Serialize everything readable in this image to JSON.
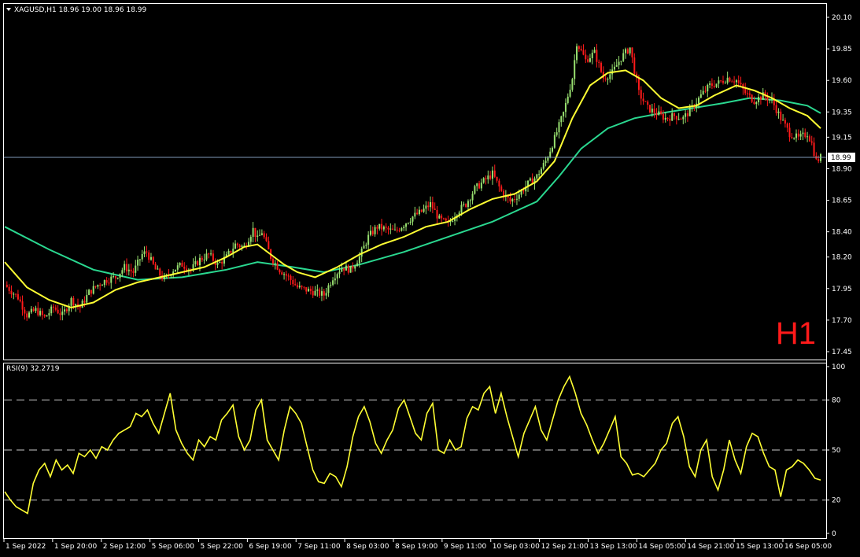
{
  "window": {
    "symbol_header": "XAGUSD,H1  18.96 19.00 18.96 18.99",
    "timeframe_watermark": "H1",
    "current_price_label": "18.99"
  },
  "rsi_header": "RSI(9) 32.2719",
  "colors": {
    "background": "#000000",
    "frame": "#ffffff",
    "bull_candle": "#98e070",
    "bear_candle": "#ff1a1a",
    "ma_fast": "#ffff33",
    "ma_slow": "#2ad890",
    "rsi_line": "#ffff33",
    "watermark": "#ff1a1a",
    "current_price_line": "#7f9ab8"
  },
  "chart_data": [
    {
      "type": "candlestick",
      "symbol": "XAGUSD",
      "timeframe": "H1",
      "ylim": [
        17.45,
        20.15
      ],
      "y_ticks": [
        "20.10",
        "19.85",
        "19.60",
        "19.35",
        "19.15",
        "18.90",
        "18.65",
        "18.40",
        "18.20",
        "17.95",
        "17.70",
        "17.45"
      ],
      "current_price": 18.99,
      "x_tick_labels": [
        "1 Sep 2022",
        "1 Sep 20:00",
        "2 Sep 12:00",
        "5 Sep 06:00",
        "5 Sep 22:00",
        "6 Sep 19:00",
        "7 Sep 11:00",
        "8 Sep 03:00",
        "8 Sep 19:00",
        "9 Sep 11:00",
        "10 Sep 03:00",
        "12 Sep 21:00",
        "13 Sep 13:00",
        "14 Sep 05:00",
        "14 Sep 21:00",
        "15 Sep 13:00",
        "16 Sep 05:00"
      ],
      "close_path": [
        [
          0,
          17.98
        ],
        [
          6,
          17.88
        ],
        [
          10,
          17.74
        ],
        [
          14,
          17.78
        ],
        [
          18,
          17.72
        ],
        [
          22,
          17.8
        ],
        [
          26,
          17.74
        ],
        [
          30,
          17.86
        ],
        [
          34,
          17.8
        ],
        [
          38,
          17.92
        ],
        [
          42,
          17.98
        ],
        [
          46,
          18.02
        ],
        [
          50,
          18.04
        ],
        [
          54,
          18.12
        ],
        [
          58,
          18.08
        ],
        [
          62,
          18.22
        ],
        [
          64,
          18.24
        ],
        [
          68,
          18.1
        ],
        [
          72,
          18.02
        ],
        [
          76,
          18.1
        ],
        [
          80,
          18.14
        ],
        [
          84,
          18.1
        ],
        [
          88,
          18.18
        ],
        [
          92,
          18.22
        ],
        [
          96,
          18.14
        ],
        [
          100,
          18.2
        ],
        [
          104,
          18.3
        ],
        [
          108,
          18.28
        ],
        [
          112,
          18.42
        ],
        [
          114,
          18.34
        ],
        [
          116,
          18.4
        ],
        [
          120,
          18.2
        ],
        [
          124,
          18.1
        ],
        [
          128,
          18.04
        ],
        [
          132,
          17.96
        ],
        [
          136,
          17.94
        ],
        [
          140,
          17.92
        ],
        [
          144,
          17.9
        ],
        [
          148,
          18.04
        ],
        [
          152,
          18.12
        ],
        [
          156,
          18.1
        ],
        [
          160,
          18.2
        ],
        [
          164,
          18.36
        ],
        [
          168,
          18.44
        ],
        [
          172,
          18.42
        ],
        [
          176,
          18.4
        ],
        [
          180,
          18.46
        ],
        [
          184,
          18.52
        ],
        [
          188,
          18.56
        ],
        [
          192,
          18.62
        ],
        [
          196,
          18.5
        ],
        [
          200,
          18.46
        ],
        [
          204,
          18.56
        ],
        [
          208,
          18.62
        ],
        [
          212,
          18.74
        ],
        [
          216,
          18.8
        ],
        [
          220,
          18.86
        ],
        [
          224,
          18.72
        ],
        [
          228,
          18.64
        ],
        [
          232,
          18.7
        ],
        [
          236,
          18.78
        ],
        [
          240,
          18.84
        ],
        [
          244,
          18.96
        ],
        [
          248,
          19.14
        ],
        [
          252,
          19.34
        ],
        [
          256,
          19.62
        ],
        [
          258,
          19.9
        ],
        [
          262,
          19.76
        ],
        [
          266,
          19.82
        ],
        [
          270,
          19.62
        ],
        [
          274,
          19.66
        ],
        [
          278,
          19.78
        ],
        [
          282,
          19.86
        ],
        [
          286,
          19.5
        ],
        [
          290,
          19.38
        ],
        [
          294,
          19.34
        ],
        [
          298,
          19.3
        ],
        [
          302,
          19.32
        ],
        [
          306,
          19.3
        ],
        [
          310,
          19.38
        ],
        [
          314,
          19.48
        ],
        [
          318,
          19.56
        ],
        [
          322,
          19.58
        ],
        [
          326,
          19.62
        ],
        [
          330,
          19.6
        ],
        [
          334,
          19.5
        ],
        [
          338,
          19.44
        ],
        [
          342,
          19.48
        ],
        [
          346,
          19.44
        ],
        [
          350,
          19.3
        ],
        [
          354,
          19.18
        ],
        [
          358,
          19.14
        ],
        [
          362,
          19.18
        ],
        [
          364,
          19.1
        ],
        [
          366,
          18.96
        ],
        [
          368,
          18.99
        ]
      ],
      "ma_fast_path": [
        [
          0,
          18.16
        ],
        [
          10,
          17.96
        ],
        [
          20,
          17.86
        ],
        [
          30,
          17.8
        ],
        [
          40,
          17.84
        ],
        [
          50,
          17.94
        ],
        [
          60,
          18.0
        ],
        [
          70,
          18.04
        ],
        [
          80,
          18.08
        ],
        [
          90,
          18.12
        ],
        [
          100,
          18.2
        ],
        [
          108,
          18.28
        ],
        [
          114,
          18.3
        ],
        [
          120,
          18.22
        ],
        [
          126,
          18.14
        ],
        [
          132,
          18.08
        ],
        [
          140,
          18.04
        ],
        [
          150,
          18.12
        ],
        [
          160,
          18.22
        ],
        [
          170,
          18.3
        ],
        [
          180,
          18.36
        ],
        [
          190,
          18.44
        ],
        [
          200,
          18.48
        ],
        [
          210,
          18.58
        ],
        [
          220,
          18.66
        ],
        [
          230,
          18.7
        ],
        [
          240,
          18.8
        ],
        [
          248,
          18.96
        ],
        [
          256,
          19.3
        ],
        [
          264,
          19.56
        ],
        [
          272,
          19.66
        ],
        [
          280,
          19.68
        ],
        [
          288,
          19.6
        ],
        [
          296,
          19.46
        ],
        [
          304,
          19.38
        ],
        [
          312,
          19.4
        ],
        [
          320,
          19.48
        ],
        [
          330,
          19.56
        ],
        [
          338,
          19.52
        ],
        [
          346,
          19.46
        ],
        [
          354,
          19.38
        ],
        [
          362,
          19.32
        ],
        [
          368,
          19.22
        ]
      ],
      "ma_slow_path": [
        [
          0,
          18.44
        ],
        [
          20,
          18.26
        ],
        [
          40,
          18.1
        ],
        [
          60,
          18.02
        ],
        [
          80,
          18.04
        ],
        [
          100,
          18.1
        ],
        [
          114,
          18.16
        ],
        [
          130,
          18.12
        ],
        [
          144,
          18.08
        ],
        [
          160,
          18.14
        ],
        [
          180,
          18.24
        ],
        [
          200,
          18.36
        ],
        [
          220,
          18.48
        ],
        [
          240,
          18.64
        ],
        [
          250,
          18.84
        ],
        [
          260,
          19.06
        ],
        [
          272,
          19.22
        ],
        [
          284,
          19.3
        ],
        [
          296,
          19.34
        ],
        [
          310,
          19.38
        ],
        [
          324,
          19.42
        ],
        [
          336,
          19.46
        ],
        [
          350,
          19.44
        ],
        [
          362,
          19.4
        ],
        [
          368,
          19.34
        ]
      ]
    },
    {
      "type": "line",
      "name": "RSI(9)",
      "current_value": 32.2719,
      "ylim": [
        0,
        100
      ],
      "y_ticks": [
        "100",
        "80",
        "50",
        "20",
        "0"
      ],
      "levels": [
        80,
        50,
        20
      ],
      "x_span": 368,
      "rsi_values": [
        25,
        20,
        16,
        14,
        12,
        30,
        38,
        42,
        34,
        44,
        38,
        41,
        36,
        48,
        46,
        50,
        45,
        52,
        50,
        56,
        60,
        62,
        64,
        72,
        70,
        74,
        66,
        60,
        72,
        84,
        62,
        54,
        48,
        44,
        56,
        52,
        58,
        56,
        68,
        72,
        77,
        58,
        50,
        56,
        74,
        80,
        56,
        50,
        44,
        62,
        76,
        72,
        66,
        52,
        38,
        31,
        30,
        36,
        34,
        28,
        40,
        58,
        70,
        76,
        67,
        54,
        48,
        56,
        62,
        75,
        80,
        70,
        60,
        56,
        72,
        78,
        50,
        48,
        56,
        50,
        52,
        69,
        76,
        74,
        84,
        88,
        72,
        84,
        70,
        58,
        46,
        60,
        68,
        76,
        62,
        56,
        68,
        80,
        88,
        94,
        84,
        72,
        65,
        56,
        48,
        54,
        62,
        70,
        46,
        42,
        35,
        36,
        34,
        38,
        42,
        50,
        54,
        66,
        70,
        58,
        40,
        34,
        50,
        56,
        34,
        26,
        38,
        56,
        44,
        36,
        52,
        60,
        58,
        48,
        40,
        38,
        22,
        38,
        40,
        44,
        42,
        38,
        33,
        32
      ]
    }
  ]
}
